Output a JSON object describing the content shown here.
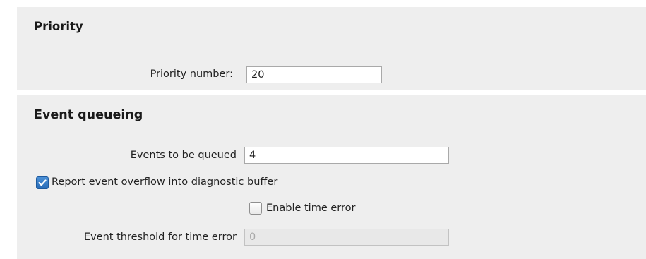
{
  "priority": {
    "title": "Priority",
    "priority_number_label": "Priority number:",
    "priority_number_value": "20"
  },
  "event_queueing": {
    "title": "Event queueing",
    "events_to_be_queued_label": "Events to be queued",
    "events_to_be_queued_value": "4",
    "report_overflow_label": "Report event overflow into diagnostic buffer",
    "report_overflow_checked": true,
    "enable_time_error_label": "Enable time error",
    "enable_time_error_checked": false,
    "threshold_label": "Event threshold for time error",
    "threshold_value": "0",
    "threshold_disabled": true
  },
  "colors": {
    "panel_background": "#eeeeee",
    "checkbox_checked": "#2a6db8"
  }
}
